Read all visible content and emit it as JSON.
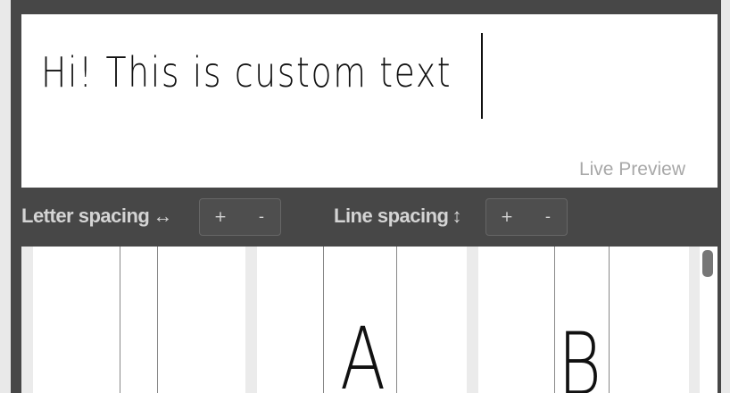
{
  "preview": {
    "text": "Hi! This is custom text",
    "label": "Live Preview"
  },
  "letter_spacing": {
    "label": "Letter spacing",
    "arrow": "↔",
    "plus": "+",
    "minus": "-"
  },
  "line_spacing": {
    "label": "Line spacing",
    "arrow": "↕",
    "plus": "+",
    "minus": "-"
  },
  "glyphs": [
    {
      "char": "A"
    },
    {
      "char": "B"
    }
  ]
}
